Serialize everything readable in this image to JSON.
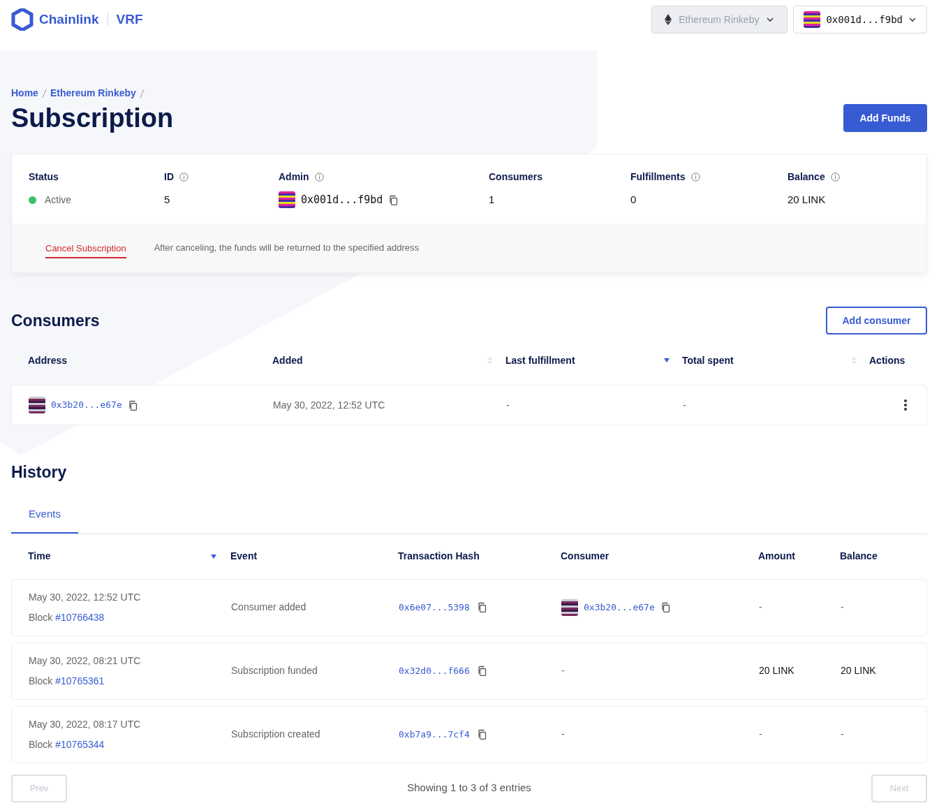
{
  "header": {
    "brand": "Chainlink",
    "product": "VRF",
    "network": {
      "label": "Ethereum Rinkeby",
      "disabled": true
    },
    "account": {
      "label": "0x001d...f9bd"
    }
  },
  "breadcrumbs": [
    {
      "label": "Home"
    },
    {
      "label": "Ethereum Rinkeby"
    }
  ],
  "title": "Subscription",
  "add_funds": "Add Funds",
  "summary": [
    {
      "kind": "status",
      "label": "Status",
      "value": "Active",
      "color": "#3fbf6f",
      "info": false
    },
    {
      "kind": "text",
      "label": "ID",
      "value": "5",
      "info": true
    },
    {
      "kind": "address",
      "label": "Admin",
      "value": "0x001d...f9bd",
      "info": true
    },
    {
      "kind": "text",
      "label": "Consumers",
      "value": "1",
      "info": false
    },
    {
      "kind": "text",
      "label": "Fulfillments",
      "value": "0",
      "info": true
    },
    {
      "kind": "text",
      "label": "Balance",
      "value": "20 LINK",
      "info": true
    }
  ],
  "cancel": {
    "link": "Cancel Subscription",
    "note": "After canceling, the funds will be returned to the specified address"
  },
  "consumers": {
    "title": "Consumers",
    "add_button": "Add consumer",
    "columns": [
      {
        "label": "Address",
        "sortable": false,
        "sorted": false
      },
      {
        "label": "Added",
        "sortable": true,
        "sorted": false
      },
      {
        "label": "Last fulfillment",
        "sortable": true,
        "sorted": true
      },
      {
        "label": "Total spent",
        "sortable": true,
        "sorted": false
      },
      {
        "label": "Actions",
        "sortable": false,
        "sorted": false
      }
    ],
    "rows": [
      {
        "address": "0x3b20...e67e",
        "added": "May 30, 2022, 12:52 UTC",
        "last_fulfillment": "-",
        "total_spent": "-"
      }
    ]
  },
  "history": {
    "title": "History",
    "tabs": [
      {
        "label": "Events",
        "selected": true
      }
    ],
    "columns": [
      {
        "label": "Time",
        "sortable": true,
        "sorted": true
      },
      {
        "label": "Event",
        "sortable": false,
        "sorted": false
      },
      {
        "label": "Transaction Hash",
        "sortable": false,
        "sorted": false
      },
      {
        "label": "Consumer",
        "sortable": false,
        "sorted": false
      },
      {
        "label": "Amount",
        "sortable": false,
        "sorted": false
      },
      {
        "label": "Balance",
        "sortable": false,
        "sorted": false
      }
    ],
    "rows": [
      {
        "time": "May 30, 2022, 12:52 UTC",
        "block_label": "Block",
        "block": "#10766438",
        "event": "Consumer added",
        "hash": "0x6e07...5398",
        "consumer": "0x3b20...e67e",
        "amount": "-",
        "balance": "-"
      },
      {
        "time": "May 30, 2022, 08:21 UTC",
        "block_label": "Block",
        "block": "#10765361",
        "event": "Subscription funded",
        "hash": "0x32d0...f666",
        "consumer": "-",
        "amount": "20 LINK",
        "balance": "20 LINK"
      },
      {
        "time": "May 30, 2022, 08:17 UTC",
        "block_label": "Block",
        "block": "#10765344",
        "event": "Subscription created",
        "hash": "0xb7a9...7cf4",
        "consumer": "-",
        "amount": "-",
        "balance": "-"
      }
    ]
  },
  "pagination": {
    "prev": {
      "label": "Prev",
      "disabled": true
    },
    "summary": "Showing 1 to 3 of 3 entries",
    "next": {
      "label": "Next",
      "disabled": true
    }
  }
}
